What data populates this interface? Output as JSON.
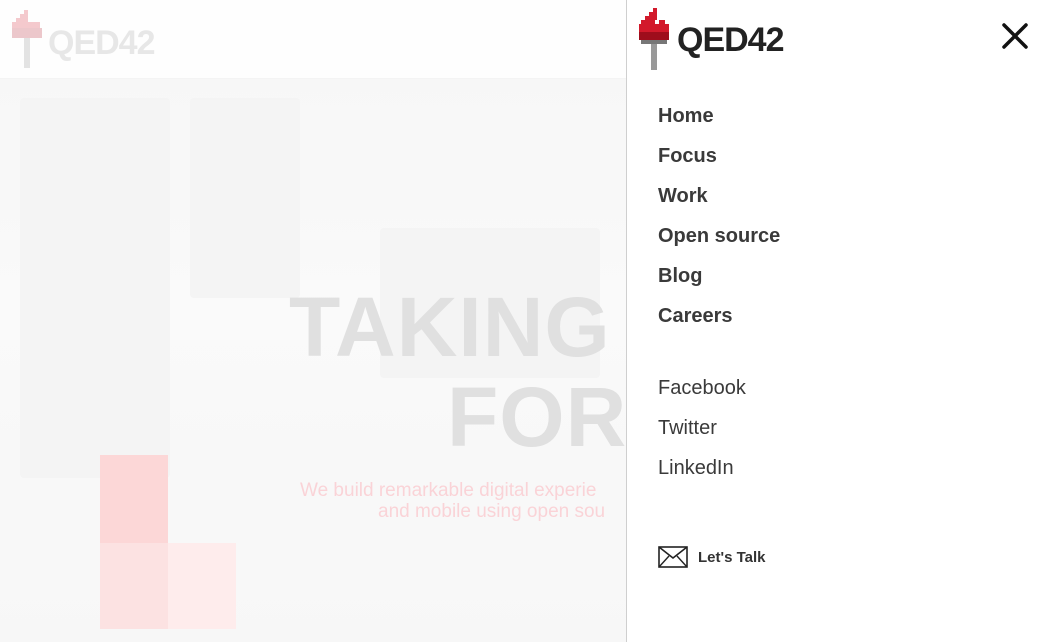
{
  "brand": {
    "name": "QED42",
    "accent": "#d2192b"
  },
  "hero": {
    "title_line1": "TAKING DI",
    "title_line2": "FORWA",
    "subtitle_line1": "We build remarkable digital experie",
    "subtitle_line2": "and mobile using open sou"
  },
  "menu": {
    "close_icon": "close-icon",
    "nav": [
      {
        "label": "Home"
      },
      {
        "label": "Focus"
      },
      {
        "label": "Work"
      },
      {
        "label": "Open source"
      },
      {
        "label": "Blog"
      },
      {
        "label": "Careers"
      }
    ],
    "social": [
      {
        "label": "Facebook"
      },
      {
        "label": "Twitter"
      },
      {
        "label": "LinkedIn"
      }
    ],
    "contact": {
      "label": "Let's Talk",
      "icon": "envelope-icon"
    }
  }
}
